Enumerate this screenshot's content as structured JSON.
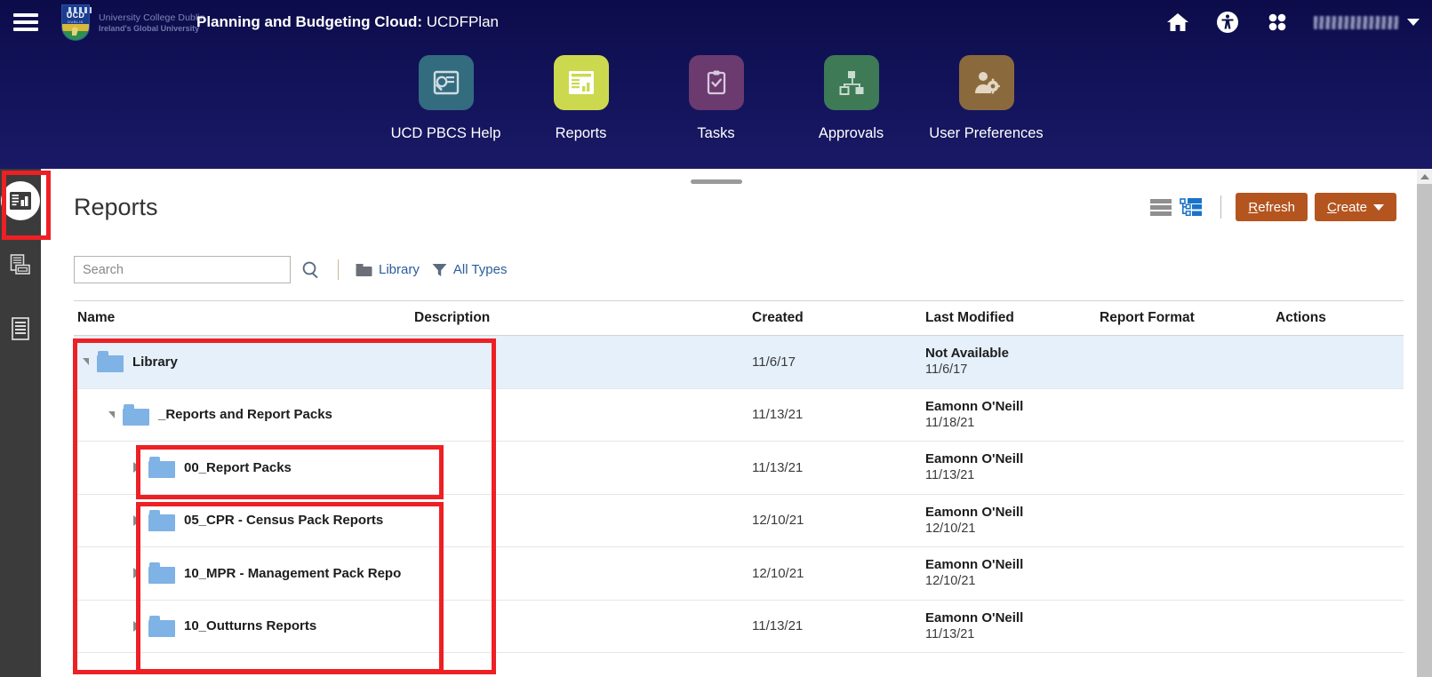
{
  "topbar": {
    "menu_icon": "hamburger-menu-icon",
    "logo": {
      "crest_text": "UCD",
      "crest_sub": "DUBLIN",
      "line1": "University College Dublin",
      "line2": "Ireland's Global University"
    },
    "title_label": "Planning and Budgeting Cloud:",
    "title_instance": " UCDFPlan",
    "icons": [
      {
        "name": "home-icon",
        "label": "Home"
      },
      {
        "name": "accessibility-icon",
        "label": "Accessibility"
      },
      {
        "name": "app-grid-icon",
        "label": "Navigator"
      }
    ],
    "user": {
      "name": "",
      "caret": "chevron-down-icon"
    }
  },
  "nav_cards": [
    {
      "label": "UCD PBCS Help",
      "icon": "help-screen-icon",
      "color": "#336b7f",
      "active": false
    },
    {
      "label": "Reports",
      "icon": "report-icon",
      "color": "#ccd94f",
      "active": true
    },
    {
      "label": "Tasks",
      "icon": "clipboard-check-icon",
      "color": "#6b3a6e",
      "active": false
    },
    {
      "label": "Approvals",
      "icon": "hierarchy-icon",
      "color": "#3e7a55",
      "active": false
    },
    {
      "label": "User Preferences",
      "icon": "user-gear-icon",
      "color": "#8a6a3d",
      "active": false
    }
  ],
  "left_rail": [
    {
      "name": "reports-rail-icon",
      "label": "Reports",
      "active": true
    },
    {
      "name": "documents-rail-icon",
      "label": "Documents",
      "active": false
    },
    {
      "name": "report-list-rail-icon",
      "label": "Report List",
      "active": false
    }
  ],
  "page": {
    "title": "Reports",
    "view_toggles": [
      {
        "name": "list-view-toggle",
        "label": "List View",
        "active": false
      },
      {
        "name": "tree-view-toggle",
        "label": "Tree View",
        "active": true
      }
    ],
    "refresh_label": "Refresh",
    "refresh_accel": "R",
    "refresh_rest": "efresh",
    "create_label": "Create",
    "create_accel": "C",
    "create_rest": "reate",
    "accent_color": "#b4551f"
  },
  "search": {
    "placeholder": "Search",
    "value": "",
    "search_icon": "magnifier-icon",
    "filters": [
      {
        "name": "library-filter",
        "icon": "folder-icon",
        "label": "Library"
      },
      {
        "name": "all-types-filter",
        "icon": "funnel-icon",
        "label": "All Types"
      }
    ]
  },
  "table": {
    "columns": [
      "Name",
      "Description",
      "Created",
      "Last Modified",
      "Report Format",
      "Actions"
    ],
    "rows": [
      {
        "name": "Library",
        "depth": 0,
        "expanded": true,
        "selected": true,
        "description": "",
        "created": "11/6/17",
        "modified_by": "Not Available",
        "modified_date": "11/6/17",
        "format": "",
        "actions": ""
      },
      {
        "name": "_Reports and Report Packs",
        "depth": 1,
        "expanded": true,
        "selected": false,
        "description": "",
        "created": "11/13/21",
        "modified_by": "Eamonn O'Neill",
        "modified_date": "11/18/21",
        "format": "",
        "actions": ""
      },
      {
        "name": "00_Report Packs",
        "depth": 2,
        "expanded": false,
        "selected": false,
        "description": "",
        "created": "11/13/21",
        "modified_by": "Eamonn O'Neill",
        "modified_date": "11/13/21",
        "format": "",
        "actions": ""
      },
      {
        "name": "05_CPR - Census Pack Reports",
        "depth": 2,
        "expanded": false,
        "selected": false,
        "description": "",
        "created": "12/10/21",
        "modified_by": "Eamonn O'Neill",
        "modified_date": "12/10/21",
        "format": "",
        "actions": ""
      },
      {
        "name": "10_MPR - Management Pack Repo",
        "depth": 2,
        "expanded": false,
        "selected": false,
        "description": "",
        "created": "12/10/21",
        "modified_by": "Eamonn O'Neill",
        "modified_date": "12/10/21",
        "format": "",
        "actions": ""
      },
      {
        "name": "10_Outturns Reports",
        "depth": 2,
        "expanded": false,
        "selected": false,
        "description": "",
        "created": "11/13/21",
        "modified_by": "Eamonn O'Neill",
        "modified_date": "11/13/21",
        "format": "",
        "actions": ""
      }
    ]
  },
  "annotations": {
    "color": "#ed2024",
    "boxes": [
      {
        "name": "rail-reports-highlight"
      },
      {
        "name": "library-tree-highlight"
      },
      {
        "name": "report-packs-highlight"
      },
      {
        "name": "pack-folders-highlight"
      }
    ]
  },
  "scrollbar": {
    "name": "vertical-scrollbar",
    "up_arrow": "scroll-up-icon"
  }
}
